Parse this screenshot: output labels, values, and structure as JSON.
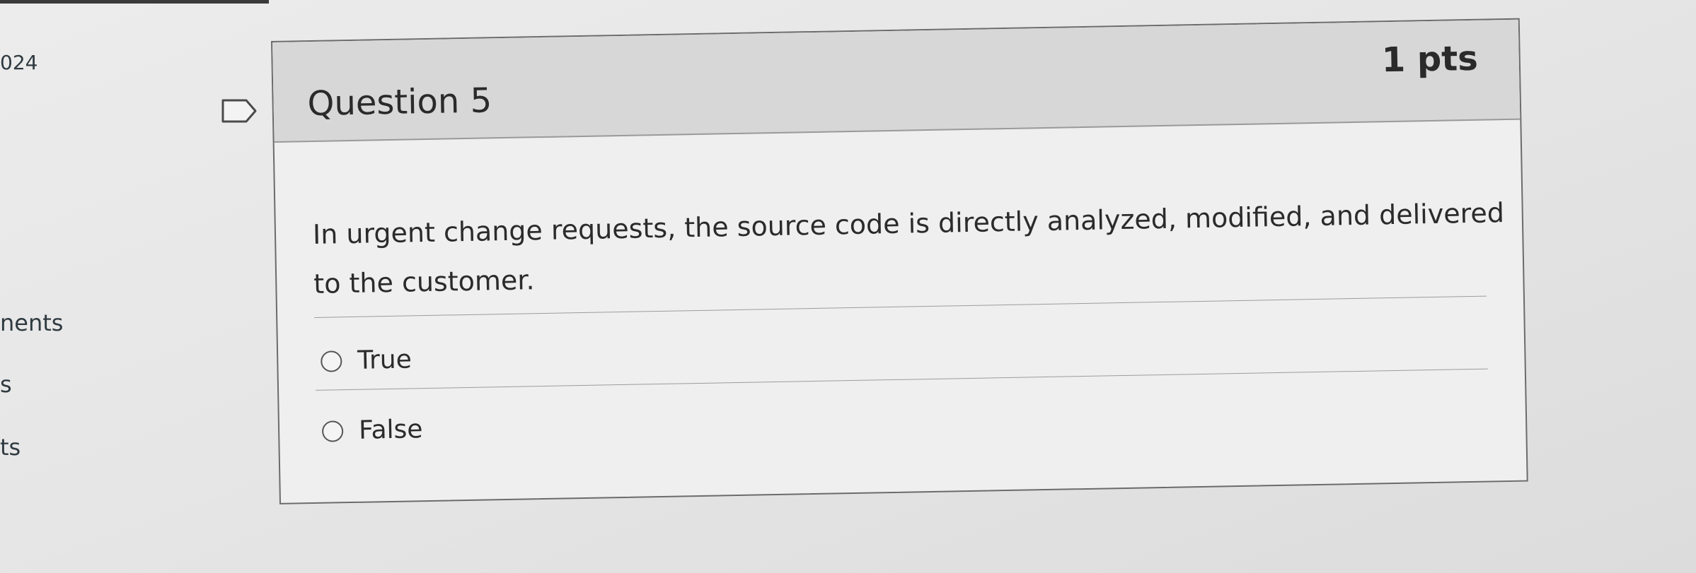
{
  "sidebar": {
    "fragments": [
      "024",
      "nents",
      "s",
      "ts"
    ]
  },
  "question": {
    "title": "Question 5",
    "points": "1 pts",
    "text": "In urgent change requests, the source code is directly analyzed, modified, and delivered to the customer.",
    "answers": [
      "True",
      "False"
    ],
    "selected": null
  },
  "icons": {
    "flag": "flag-outline-icon",
    "radio": "radio-unchecked-icon"
  },
  "colors": {
    "header_bg": "#d7d7d7",
    "card_bg": "#efefef",
    "border": "#6b6b6b"
  }
}
